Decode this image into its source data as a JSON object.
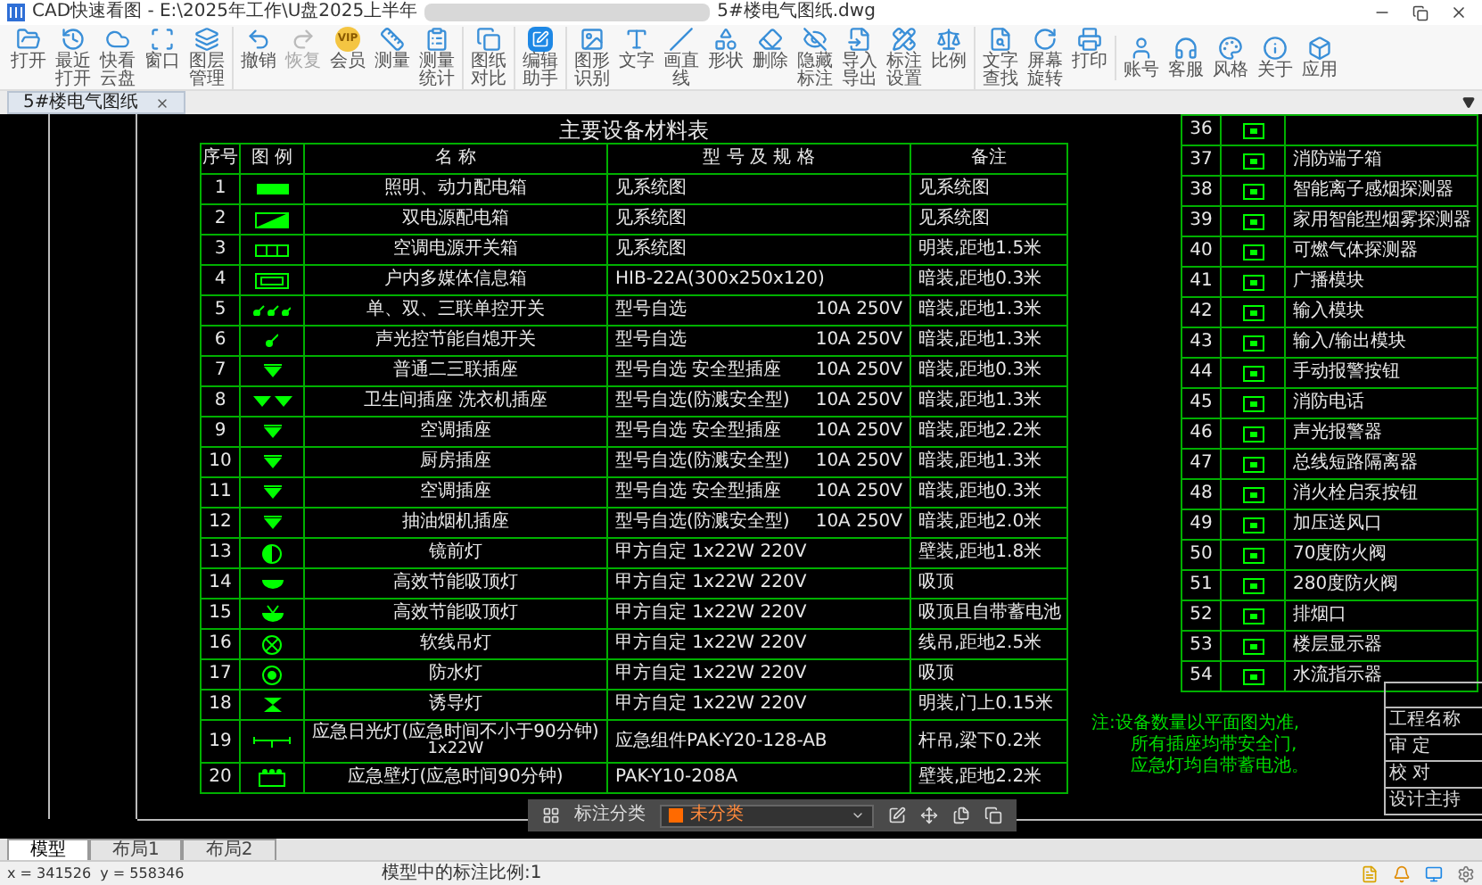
{
  "window": {
    "title": "CAD快速看图 - E:\\2025年工作\\U盘2025上半年",
    "file": "5#楼电气图纸.dwg"
  },
  "toolbar": {
    "groups": [
      [
        {
          "label": "打开",
          "disabled": false
        },
        {
          "label": "最近打开",
          "disabled": false
        },
        {
          "label": "快看云盘",
          "disabled": false
        },
        {
          "label": "窗口",
          "disabled": false
        },
        {
          "label": "图层管理",
          "disabled": false
        }
      ],
      [
        {
          "label": "撤销",
          "disabled": false
        },
        {
          "label": "恢复",
          "disabled": true
        },
        {
          "label": "会员",
          "disabled": false,
          "badge": "VIP"
        },
        {
          "label": "测量",
          "disabled": false
        },
        {
          "label": "测量统计",
          "disabled": false
        }
      ],
      [
        {
          "label": "图纸对比",
          "disabled": false
        }
      ],
      [
        {
          "label": "编辑助手",
          "disabled": false
        }
      ],
      [
        {
          "label": "图形识别",
          "disabled": false
        },
        {
          "label": "文字",
          "disabled": false
        },
        {
          "label": "画直线",
          "disabled": false
        },
        {
          "label": "形状",
          "disabled": false
        },
        {
          "label": "删除",
          "disabled": false
        },
        {
          "label": "隐藏标注",
          "disabled": false
        },
        {
          "label": "导入导出",
          "disabled": false
        },
        {
          "label": "标注设置",
          "disabled": false
        },
        {
          "label": "比例",
          "disabled": false
        }
      ],
      [
        {
          "label": "文字查找",
          "disabled": false
        },
        {
          "label": "屏幕旋转",
          "disabled": false
        },
        {
          "label": "打印",
          "disabled": false
        }
      ],
      [
        {
          "label": "账号",
          "disabled": false
        },
        {
          "label": "客服",
          "disabled": false
        },
        {
          "label": "风格",
          "disabled": false
        },
        {
          "label": "关于",
          "disabled": false
        },
        {
          "label": "应用",
          "disabled": false
        }
      ]
    ]
  },
  "doc_tabs": [
    {
      "label": "5#楼电气图纸",
      "selected": true
    }
  ],
  "material_table": {
    "title": "主要设备材料表",
    "columns": [
      "序号",
      "图 例",
      "名 称",
      "型 号 及 规 格",
      "备注"
    ],
    "rows": [
      {
        "no": "1",
        "kind": "panel",
        "name": "照明、动力配电箱",
        "model": "见系统图",
        "remark": "见系统图"
      },
      {
        "no": "2",
        "kind": "dualpanel",
        "name": "双电源配电箱",
        "model": "见系统图",
        "remark": "见系统图"
      },
      {
        "no": "3",
        "kind": "switchbox",
        "name": "空调电源开关箱",
        "model": "见系统图",
        "remark": "明装,距地1.5米"
      },
      {
        "no": "4",
        "kind": "infobox",
        "name": "户内多媒体信息箱",
        "model": "HIB-22A(300x250x120)",
        "remark": "暗装,距地0.3米"
      },
      {
        "no": "5",
        "kind": "switches",
        "name": "单、双、三联单控开关",
        "model": "型号自选",
        "rating": "10A 250V",
        "remark": "暗装,距地1.3米"
      },
      {
        "no": "6",
        "kind": "switch",
        "name": "声光控节能自熄开关",
        "model": "型号自选",
        "rating": "10A 250V",
        "remark": "暗装,距地1.3米"
      },
      {
        "no": "7",
        "kind": "socket",
        "name": "普通二三联插座",
        "model": "型号自选 安全型插座",
        "rating": "10A 250V",
        "remark": "暗装,距地0.3米"
      },
      {
        "no": "8",
        "kind": "sockets",
        "name": "卫生间插座 洗衣机插座",
        "model": "型号自选(防溅安全型)",
        "rating": "10A 250V",
        "remark": "暗装,距地1.3米"
      },
      {
        "no": "9",
        "kind": "socket",
        "name": "空调插座",
        "model": "型号自选 安全型插座",
        "rating": "10A 250V",
        "remark": "暗装,距地2.2米"
      },
      {
        "no": "10",
        "kind": "socket",
        "name": "厨房插座",
        "model": "型号自选(防溅安全型)",
        "rating": "10A 250V",
        "remark": "暗装,距地1.3米"
      },
      {
        "no": "11",
        "kind": "socket",
        "name": "空调插座",
        "model": "型号自选 安全型插座",
        "rating": "10A 250V",
        "remark": "暗装,距地0.3米"
      },
      {
        "no": "12",
        "kind": "socket",
        "name": "抽油烟机插座",
        "model": "型号自选(防溅安全型)",
        "rating": "10A 250V",
        "remark": "暗装,距地2.0米"
      },
      {
        "no": "13",
        "kind": "halfcircle",
        "name": "镜前灯",
        "model": "甲方自定 1x22W 220V",
        "remark": "壁装,距地1.8米"
      },
      {
        "no": "14",
        "kind": "ceiling",
        "name": "高效节能吸顶灯",
        "model": "甲方自定 1x22W 220V",
        "remark": "吸顶"
      },
      {
        "no": "15",
        "kind": "emergency",
        "name": "高效节能吸顶灯",
        "model": "甲方自定 1x22W 220V",
        "remark": "吸顶且自带蓄电池"
      },
      {
        "no": "16",
        "kind": "crosscircle",
        "name": "软线吊灯",
        "model": "甲方自定 1x22W 220V",
        "remark": "线吊,距地2.5米"
      },
      {
        "no": "17",
        "kind": "dotcircle",
        "name": "防水灯",
        "model": "甲方自定 1x22W 220V",
        "remark": "吸顶"
      },
      {
        "no": "18",
        "kind": "exit",
        "name": "诱导灯",
        "model": "甲方自定 1x22W 220V",
        "remark": "明装,门上0.15米"
      },
      {
        "no": "19",
        "kind": "tube",
        "name": "应急日光灯(应急时间不小于90分钟)",
        "name_note": "1x22W",
        "model": "应急组件PAK-Y20-128-AB",
        "remark": "杆吊,梁下0.2米"
      },
      {
        "no": "20",
        "kind": "battery",
        "name": "应急壁灯(应急时间90分钟)",
        "model": "PAK-Y10-208A",
        "remark": "壁装,距地2.2米"
      }
    ]
  },
  "fire_table": {
    "rows": [
      {
        "no": "36"
      },
      {
        "no": "37",
        "name": "消防端子箱"
      },
      {
        "no": "38",
        "name": "智能离子感烟探测器"
      },
      {
        "no": "39",
        "name": "家用智能型烟雾探测器"
      },
      {
        "no": "40",
        "name": "可燃气体探测器"
      },
      {
        "no": "41",
        "name": "广播模块"
      },
      {
        "no": "42",
        "name": "输入模块"
      },
      {
        "no": "43",
        "name": "输入/输出模块"
      },
      {
        "no": "44",
        "name": "手动报警按钮"
      },
      {
        "no": "45",
        "name": "消防电话"
      },
      {
        "no": "46",
        "name": "声光报警器"
      },
      {
        "no": "47",
        "name": "总线短路隔离器"
      },
      {
        "no": "48",
        "name": "消火栓启泵按钮"
      },
      {
        "no": "49",
        "name": "加压送风口"
      },
      {
        "no": "50",
        "name": "70度防火阀"
      },
      {
        "no": "51",
        "name": "280度防火阀"
      },
      {
        "no": "52",
        "name": "排烟口"
      },
      {
        "no": "53",
        "name": "楼层显示器"
      },
      {
        "no": "54",
        "name": "水流指示器"
      }
    ]
  },
  "note_lines": [
    "注:设备数量以平面图为准,",
    "所有插座均带安全门,",
    "应急灯均自带蓄电池。"
  ],
  "title_block": [
    "工程名称",
    "审 定",
    "校 对",
    "设计主持"
  ],
  "annotation_bar": {
    "label": "标注分类",
    "category": "未分类",
    "color": "#ff6a00"
  },
  "layout_tabs": [
    {
      "label": "模型",
      "selected": true
    },
    {
      "label": "布局1",
      "selected": false
    },
    {
      "label": "布局2",
      "selected": false
    }
  ],
  "status_bar": {
    "coords": "x = 341526  y = 558346",
    "scale": "模型中的标注比例:1"
  }
}
